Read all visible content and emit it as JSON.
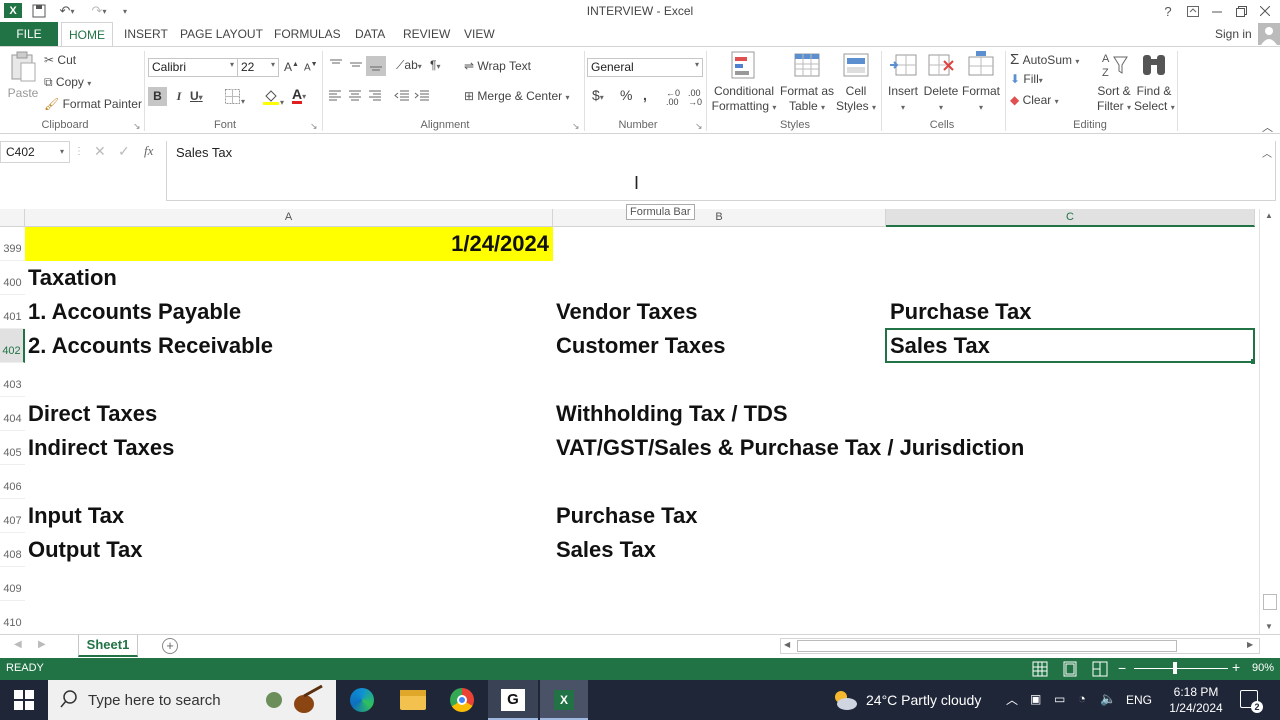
{
  "window": {
    "title": "INTERVIEW - Excel",
    "help": "?",
    "sign_in": "Sign in"
  },
  "tabs": [
    "FILE",
    "HOME",
    "INSERT",
    "PAGE LAYOUT",
    "FORMULAS",
    "DATA",
    "REVIEW",
    "VIEW"
  ],
  "clipboard": {
    "paste": "Paste",
    "cut": "Cut",
    "copy": "Copy",
    "format_painter": "Format Painter",
    "group": "Clipboard"
  },
  "font": {
    "name": "Calibri",
    "size": "22",
    "group": "Font"
  },
  "alignment": {
    "wrap_text": "Wrap Text",
    "merge_center": "Merge & Center",
    "group": "Alignment"
  },
  "number": {
    "format": "General",
    "group": "Number"
  },
  "styles": {
    "conditional_1": "Conditional",
    "conditional_2": "Formatting",
    "format_table_1": "Format as",
    "format_table_2": "Table",
    "cell_styles_1": "Cell",
    "cell_styles_2": "Styles",
    "group": "Styles"
  },
  "cells": {
    "insert": "Insert",
    "delete": "Delete",
    "format": "Format",
    "group": "Cells"
  },
  "editing": {
    "autosum": "AutoSum",
    "fill": "Fill",
    "clear": "Clear",
    "sort_1": "Sort &",
    "sort_2": "Filter",
    "find_1": "Find &",
    "find_2": "Select",
    "group": "Editing"
  },
  "formula_bar": {
    "name_box": "C402",
    "content": "Sales Tax",
    "tooltip": "Formula Bar"
  },
  "columns": [
    "A",
    "B",
    "C"
  ],
  "rows": [
    {
      "num": "399",
      "a": "",
      "a_right": "1/24/2024",
      "b": "",
      "c": ""
    },
    {
      "num": "400",
      "a": "Taxation",
      "b": "",
      "c": ""
    },
    {
      "num": "401",
      "a": "1. Accounts Payable",
      "b": "Vendor Taxes",
      "c": "Purchase Tax"
    },
    {
      "num": "402",
      "a": "2. Accounts Receivable",
      "b": "Customer Taxes",
      "c": "Sales Tax"
    },
    {
      "num": "403",
      "a": "",
      "b": "",
      "c": ""
    },
    {
      "num": "404",
      "a": "Direct Taxes",
      "b": "Withholding Tax / TDS",
      "c": ""
    },
    {
      "num": "405",
      "a": "Indirect Taxes",
      "b": "VAT/GST/Sales & Purchase Tax / Jurisdiction",
      "c": ""
    },
    {
      "num": "406",
      "a": "",
      "b": "",
      "c": ""
    },
    {
      "num": "407",
      "a": "Input Tax",
      "b": "Purchase Tax",
      "c": ""
    },
    {
      "num": "408",
      "a": "Output Tax",
      "b": "Sales Tax",
      "c": ""
    },
    {
      "num": "409",
      "a": "",
      "b": "",
      "c": ""
    },
    {
      "num": "410",
      "a": "",
      "b": "",
      "c": ""
    }
  ],
  "sheet_tab": "Sheet1",
  "status": {
    "ready": "READY",
    "zoom": "90%"
  },
  "taskbar": {
    "search_placeholder": "Type here to search",
    "weather": "24°C  Partly cloudy",
    "lang": "ENG",
    "time": "6:18 PM",
    "date": "1/24/2024"
  },
  "colors": {
    "excel_green": "#217346",
    "highlight_yellow": "#ffff00",
    "taskbar": "#1f2638"
  }
}
